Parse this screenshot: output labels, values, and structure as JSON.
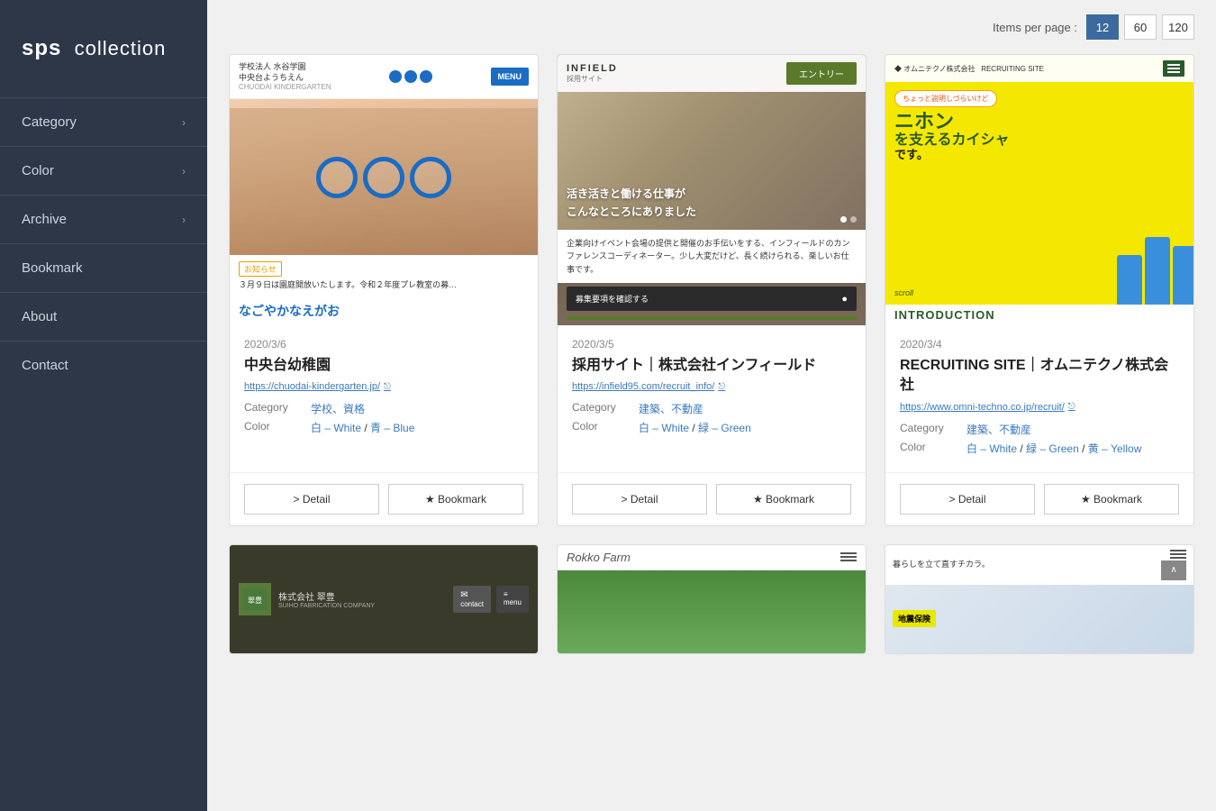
{
  "sidebar": {
    "logo": {
      "brand": "sps",
      "product": "collection"
    },
    "nav_items": [
      {
        "id": "category",
        "label": "Category",
        "has_arrow": true
      },
      {
        "id": "color",
        "label": "Color",
        "has_arrow": true
      },
      {
        "id": "archive",
        "label": "Archive",
        "has_arrow": true
      },
      {
        "id": "bookmark",
        "label": "Bookmark",
        "has_arrow": false
      },
      {
        "id": "about",
        "label": "About",
        "has_arrow": false
      },
      {
        "id": "contact",
        "label": "Contact",
        "has_arrow": false
      }
    ]
  },
  "pagination": {
    "label": "Items per page :",
    "options": [
      {
        "value": "12",
        "active": true
      },
      {
        "value": "60",
        "active": false
      },
      {
        "value": "120",
        "active": false
      }
    ]
  },
  "cards": [
    {
      "id": "card-1",
      "date": "2020/3/6",
      "title": "中央台幼稚園",
      "url": "https://chuodai-kindergarten.jp/",
      "category_label": "Category",
      "category_value": "学校、資格",
      "color_label": "Color",
      "color_value": "白 – White / 青 – Blue",
      "btn_detail": "> Detail",
      "btn_bookmark": "★ Bookmark",
      "img": {
        "header_small_text": "学校法人 水谷学園",
        "header_name": "中央台ようちえん",
        "header_sub": "CHUODAI KINDERGARTEN",
        "menu_btn": "MENU",
        "notice_tag": "お知らせ",
        "notice_text": "３月９日は園庭開放いたします。令和２年度プレ教室の募…",
        "hiragana": "なごやかなえがお"
      }
    },
    {
      "id": "card-2",
      "date": "2020/3/5",
      "title": "採用サイト｜株式会社インフィールド",
      "url": "https://infield95.com/recruit_info/",
      "category_label": "Category",
      "category_value": "建築、不動産",
      "color_label": "Color",
      "color_value": "白 – White / 緑 – Green",
      "btn_detail": "> Detail",
      "btn_bookmark": "★ Bookmark",
      "img": {
        "logo": "INFIELD",
        "subtitle": "採用サイト",
        "entry_btn": "エントリー",
        "caption_line1": "活き活きと働ける仕事が",
        "caption_line2": "こんなところにありました",
        "desc": "企業向けイベント会場の提供と開催のお手伝いをする、インフィールドのカンファレンスコーディネーター。少し大変だけど、長く続けられる、楽しいお仕事です。",
        "recruit_btn": "募集要項を確認する"
      }
    },
    {
      "id": "card-3",
      "date": "2020/3/4",
      "title": "RECRUITING SITE｜オムニテクノ株式会社",
      "url": "https://www.omni-techno.co.jp/recruit/",
      "category_label": "Category",
      "category_value": "建築、不動産",
      "color_label": "Color",
      "color_value": "白 – White / 緑 – Green / 黄 – Yellow",
      "btn_detail": "> Detail",
      "btn_bookmark": "★ Bookmark",
      "img": {
        "logo": "オムニテクノ株式会社",
        "sub": "RECRUITING SITE",
        "bubble_text": "ちょっと説明しづらいけど",
        "big_text_line1": "ニホン",
        "big_text_line2": "支えるカイシャ",
        "big_text_suffix": "です。",
        "scroll_text": "scroll",
        "intro_text": "INTRODUCTION"
      }
    },
    {
      "id": "card-4",
      "date": "",
      "title": "",
      "url": "",
      "img_type": "suiho"
    },
    {
      "id": "card-5",
      "date": "",
      "title": "",
      "url": "",
      "img_type": "rokko",
      "rokko_logo": "Rokko Farm"
    },
    {
      "id": "card-6",
      "date": "",
      "title": "",
      "url": "",
      "img_type": "jishin",
      "jishin_text": "地震保険"
    }
  ]
}
